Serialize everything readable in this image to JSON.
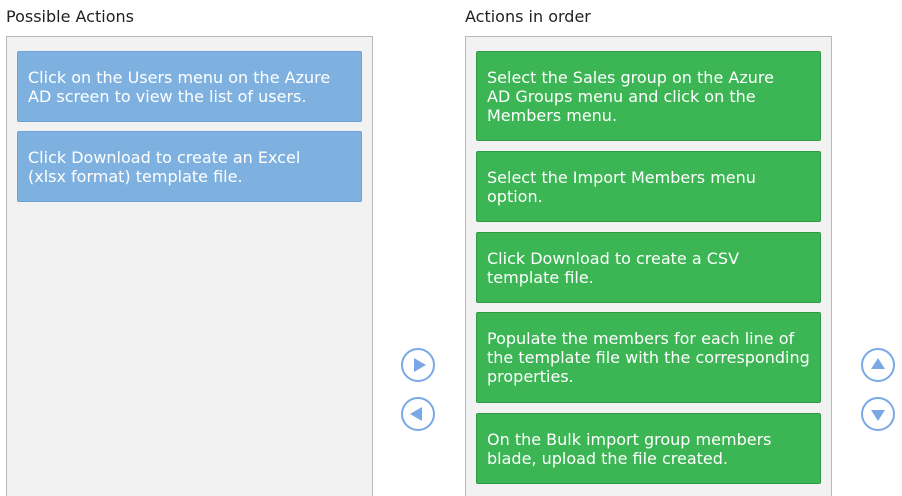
{
  "possible": {
    "heading": "Possible Actions",
    "items": [
      "Click on the Users menu on the Azure AD screen to view the list of users.",
      "Click Download to create an Excel (xlsx format) template file."
    ]
  },
  "ordered": {
    "heading": "Actions in order",
    "items": [
      "Select the Sales group on the Azure AD Groups menu and click on the Members menu.",
      "Select the Import Members menu option.",
      "Click Download to create a CSV template file.",
      "Populate the members for each line of the template file with the corresponding properties.",
      "On the Bulk import group members blade, upload the file created."
    ]
  },
  "icons": {
    "move_right": "play-right-icon",
    "move_left": "play-left-icon",
    "move_up": "arrow-up-icon",
    "move_down": "arrow-down-icon"
  },
  "colors": {
    "possible_card": "#7fb1e0",
    "ordered_card": "#3cb554",
    "button_ring": "#7aa8e6"
  }
}
